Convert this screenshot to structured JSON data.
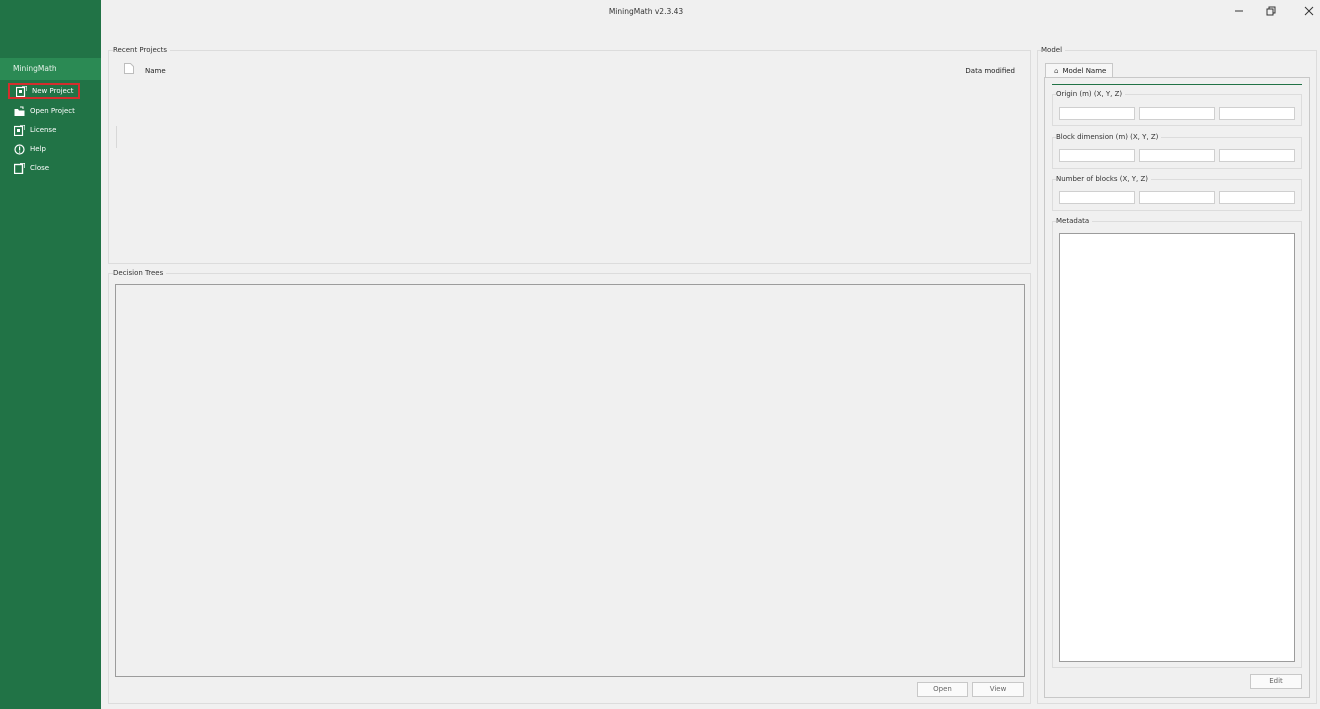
{
  "window": {
    "title": "MiningMath v2.3.43",
    "minimize_icon": "minimize-icon",
    "restore_icon": "restore-icon",
    "close_icon": "close-icon"
  },
  "sidebar": {
    "brand": "MiningMath",
    "items": [
      {
        "label": "New Project",
        "icon": "new-project-icon",
        "selected": true
      },
      {
        "label": "Open Project",
        "icon": "open-folder-icon"
      },
      {
        "label": "License",
        "icon": "license-icon"
      },
      {
        "label": "Help",
        "icon": "help-icon"
      },
      {
        "label": "Close",
        "icon": "close-project-icon"
      }
    ]
  },
  "recent_projects": {
    "title": "Recent Projects",
    "columns": {
      "name": "Name",
      "date": "Data modified"
    }
  },
  "decision_trees": {
    "title": "Decision Trees",
    "open_label": "Open",
    "view_label": "View"
  },
  "model": {
    "title": "Model",
    "tab_label": "Model Name",
    "origin_label": "Origin (m) (X, Y, Z)",
    "block_dimension_label": "Block dimension (m) (X, Y, Z)",
    "number_blocks_label": "Number of blocks (X, Y, Z)",
    "metadata_label": "Metadata",
    "edit_label": "Edit"
  },
  "colors": {
    "sidebar": "#217346",
    "sidebar_brand": "#2b8a54",
    "selection_outline": "#d42d2d",
    "tab_underline": "#217346"
  }
}
